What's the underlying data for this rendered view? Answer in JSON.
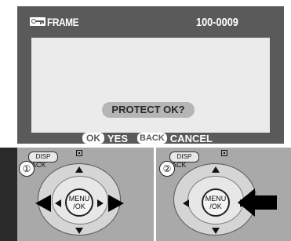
{
  "screen": {
    "title": "FRAME",
    "frame_number": "100-0009",
    "prompt": "PROTECT OK?",
    "ok_button_label": "OK",
    "yes_label": "YES",
    "back_button_label": "BACK",
    "cancel_label": "CANCEL",
    "icon": "protect-key-icon"
  },
  "steps": [
    {
      "number": "①",
      "disp_label": "DISP",
      "back_text": "ACK",
      "menu_label_top": "MENU",
      "menu_label_bottom": "/OK"
    },
    {
      "number": "②",
      "disp_label": "DISP",
      "back_text": "ACK",
      "menu_label_top": "MENU",
      "menu_label_bottom": "/OK"
    }
  ],
  "colors": {
    "lcd_dark": "#5a5a5a",
    "lcd_light": "#ebebeb",
    "panel_gray": "#a9a9a9",
    "pill": "#b5b5b5"
  }
}
